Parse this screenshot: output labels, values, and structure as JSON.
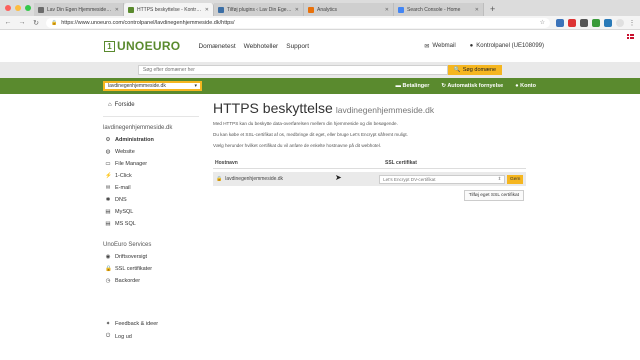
{
  "browser": {
    "tabs": [
      {
        "title": "Lav Din Egen Hjemmeside Mo...",
        "favicon_color": "#6b6b6b"
      },
      {
        "title": "HTTPS beskyttelse - Kontrolp...",
        "favicon_color": "#5a8a2e",
        "active": true
      },
      {
        "title": "Tilføj plugins ‹ Lav Din Egen H...",
        "favicon_color": "#3b6ea5"
      },
      {
        "title": "Analytics",
        "favicon_color": "#e8710a"
      },
      {
        "title": "Search Console - Home",
        "favicon_color": "#4285f4"
      }
    ],
    "new_tab": "+",
    "url": "https://www.unoeuro.com/controlpanel/lavdinegenhjemmeside.dk/https/"
  },
  "header": {
    "logo_box": "1",
    "logo_word": "UNOEURO",
    "nav": [
      "Domænetest",
      "Webhoteller",
      "Support"
    ],
    "webmail": "Webmail",
    "kontrolpanel": "Kontrolpanel (UE108099)"
  },
  "domain_search": {
    "placeholder": "Søg efter domæner her",
    "button": "Søg domæne"
  },
  "greenbar": {
    "selected_domain": "lavdinegenhjemmeside.dk",
    "links": [
      "Betalinger",
      "Automatisk fornyelse",
      "Konto"
    ]
  },
  "sidebar": {
    "frontpage": "Forside",
    "domain_heading": "lavdinegenhjemmeside.dk",
    "items": [
      {
        "label": "Administration",
        "icon": "gear-icon",
        "glyph": "⚙",
        "bold": true
      },
      {
        "label": "Website",
        "icon": "globe-icon",
        "glyph": "◍"
      },
      {
        "label": "File Manager",
        "icon": "folder-icon",
        "glyph": "▭"
      },
      {
        "label": "1-Click",
        "icon": "bolt-icon",
        "glyph": "⚡"
      },
      {
        "label": "E-mail",
        "icon": "envelope-icon",
        "glyph": "✉"
      },
      {
        "label": "DNS",
        "icon": "network-icon",
        "glyph": "✱"
      },
      {
        "label": "MySQL",
        "icon": "database-icon",
        "glyph": "▤"
      },
      {
        "label": "MS SQL",
        "icon": "database-icon",
        "glyph": "▤"
      }
    ],
    "services_heading": "UnoEuro Services",
    "services": [
      {
        "label": "Driftsoversigt",
        "icon": "monitor-icon",
        "glyph": "◉"
      },
      {
        "label": "SSL certifikater",
        "icon": "lock-icon",
        "glyph": "🔒"
      },
      {
        "label": "Backorder",
        "icon": "clock-icon",
        "glyph": "◷"
      }
    ],
    "footer": [
      {
        "label": "Feedback & ideer",
        "icon": "lightbulb-icon",
        "glyph": "✦"
      },
      {
        "label": "Log ud",
        "icon": "power-icon",
        "glyph": "⏻"
      }
    ]
  },
  "main": {
    "title": "HTTPS beskyttelse",
    "title_domain": "lavdinegenhjemmeside.dk",
    "p1": "Med HTTPS kan du beskytte data-overførelsen mellem din hjemmeside og din besøgende.",
    "p2": "Du kan købe et SSL-certifikat af os, medbringe dit eget, eller bruge Let's Encrypt såfremt muligt.",
    "p3": "Vælg herunder hvilket certifikat du vil anføre de enkelte hostnavne på dit webhotel.",
    "col_host": "Hostnavn",
    "col_ssl": "SSL certifikat",
    "row_host": "lavdinegenhjemmeside.dk",
    "row_select": "Let's Encrypt DV-certifikat",
    "save": "Gem",
    "add_cert": "Tilføj eget SSL certifikat"
  },
  "colors": {
    "brand_green": "#5a8a2e",
    "accent_yellow": "#f5b620"
  }
}
